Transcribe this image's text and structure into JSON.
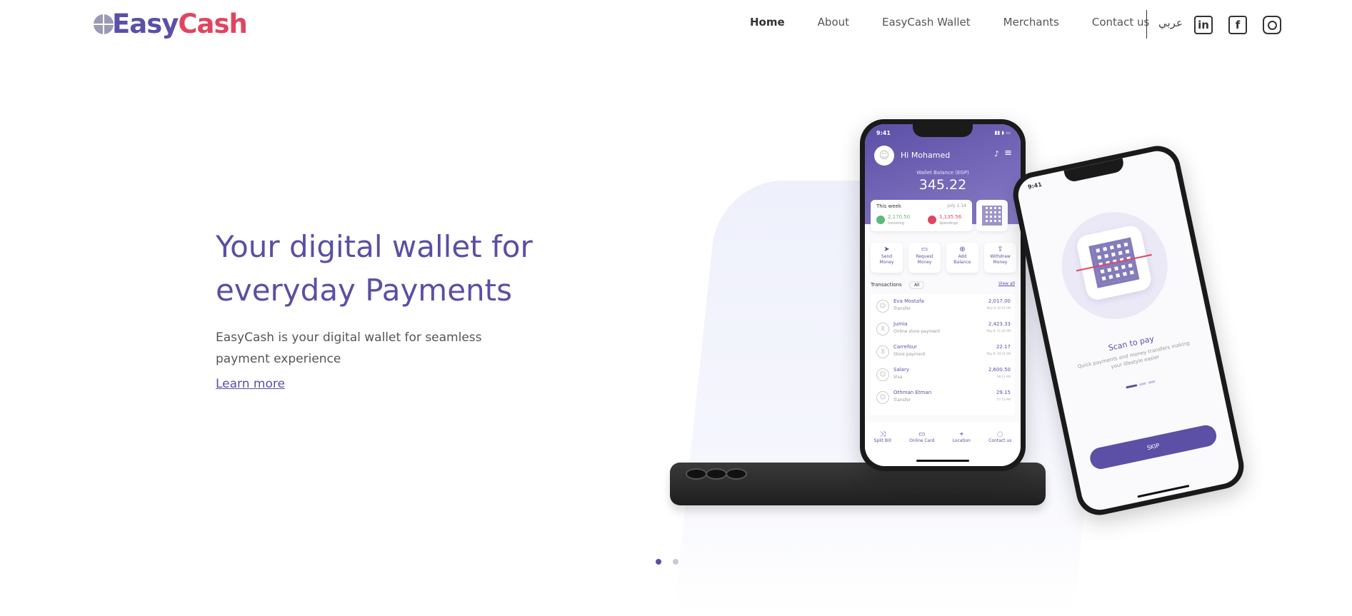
{
  "brand": {
    "logo_part1": "Easy",
    "logo_part2": "Cash",
    "accent": "#5b4fa6",
    "accent_red": "#e0455f"
  },
  "nav": {
    "items": [
      {
        "label": "Home",
        "active": true
      },
      {
        "label": "About"
      },
      {
        "label": "EasyCash Wallet"
      },
      {
        "label": "Merchants"
      },
      {
        "label": "Contact us"
      }
    ],
    "language": "عربي",
    "social": {
      "linkedin": "in",
      "facebook": "f",
      "instagram": "instagram-icon"
    }
  },
  "hero": {
    "title": "Your digital wallet for everyday Payments",
    "subtitle": "EasyCash is your digital wallet for seamless payment experience",
    "link": "Learn more"
  },
  "phone_main": {
    "time": "9:41",
    "greeting": "Hi Mohamed",
    "balance_label": "Wallet Balance (EGP)",
    "balance": "345.22",
    "week_label": "This week",
    "week_range": "July 1-14",
    "incoming_value": "2,170.50",
    "incoming_label": "Incoming",
    "spendings_value": "1,135.56",
    "spendings_label": "Spendings",
    "actions": [
      {
        "icon": "➤",
        "l1": "Send",
        "l2": "Money"
      },
      {
        "icon": "▭",
        "l1": "Request",
        "l2": "Money"
      },
      {
        "icon": "⊕",
        "l1": "Add",
        "l2": "Balance"
      },
      {
        "icon": "⇪",
        "l1": "Withdraw",
        "l2": "Money"
      }
    ],
    "transactions_label": "Transactions",
    "filter": "All",
    "view_all": "View all",
    "transactions": [
      {
        "name": "Eva Mostafa",
        "type": "Transfer",
        "amount": "2,017.00",
        "date": "May 8, 02:05 PM"
      },
      {
        "name": "Jumia",
        "type": "Online store payment",
        "amount": "2,423.33",
        "date": "May 8, 11:45 AM"
      },
      {
        "name": "Carrefour",
        "type": "Store payment",
        "amount": "22.17",
        "date": "May 8, 10:42 AM"
      },
      {
        "name": "Salary",
        "type": "Visa",
        "amount": "2,600.50",
        "date": "08:21 AM"
      },
      {
        "name": "Othman Etman",
        "type": "Transfer",
        "amount": "29.15",
        "date": "07:53 AM"
      }
    ],
    "bottom_nav": [
      {
        "icon": "⤨",
        "label": "Split Bill"
      },
      {
        "icon": "▭",
        "label": "Online Card"
      },
      {
        "icon": "⌖",
        "label": "Location"
      },
      {
        "icon": "◌",
        "label": "Contact us"
      }
    ]
  },
  "phone_second": {
    "time": "9:41",
    "title": "Scan to pay",
    "subtitle": "Quick payments and money transfers making your lifestyle easier",
    "button": "SKIP"
  },
  "slider": {
    "count": 2,
    "active_index": 0
  }
}
